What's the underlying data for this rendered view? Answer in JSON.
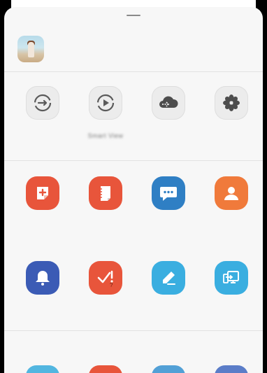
{
  "contact": {
    "name": "",
    "sub": ""
  },
  "quick_share": [
    {
      "label": "",
      "icon": "sync-arrow-icon"
    },
    {
      "label": "Smart View",
      "icon": "smart-view-play-icon"
    },
    {
      "label": "",
      "icon": "cloud-upload-icon"
    },
    {
      "label": "",
      "icon": "flower-icon"
    }
  ],
  "apps_row1": [
    {
      "label": "",
      "icon": "note-plus-icon",
      "color": "#e8553b"
    },
    {
      "label": "",
      "icon": "notebook-icon",
      "color": "#e8553b"
    },
    {
      "label": "",
      "icon": "message-icon",
      "color": "#2f7fc4"
    },
    {
      "label": "",
      "icon": "contact-icon",
      "color": "#f07a3b"
    }
  ],
  "apps_row2": [
    {
      "label": "",
      "icon": "bell-icon",
      "color": "#3b5bb5"
    },
    {
      "label": "",
      "icon": "reminder-check-icon",
      "color": "#e8553b"
    },
    {
      "label": "",
      "icon": "pen-icon",
      "color": "#3aaee0"
    },
    {
      "label": "",
      "icon": "screen-share-icon",
      "color": "#3aaee0"
    }
  ],
  "section_title": "",
  "peek_colors": [
    "#52b6e0",
    "#e8553b",
    "#52a0d6",
    "#5b7dc8"
  ]
}
